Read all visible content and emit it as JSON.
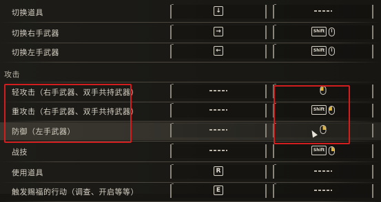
{
  "rows": [
    {
      "label": "切换道具",
      "primary": {
        "kind": "key",
        "text": "↓"
      },
      "secondary": {
        "kind": "dash"
      }
    },
    {
      "label": "切换右手武器",
      "primary": {
        "kind": "key",
        "text": "→"
      },
      "secondary": {
        "kind": "combo",
        "key": "Shift",
        "mouse": "plain"
      }
    },
    {
      "label": "切换左手武器",
      "primary": {
        "kind": "key",
        "text": "←"
      },
      "secondary": {
        "kind": "combo",
        "key": "Shift",
        "mouse": "plain"
      }
    },
    {
      "label": "轻攻击（右手武器、双手共持武器）",
      "primary": {
        "kind": "dash"
      },
      "secondary": {
        "kind": "mouse",
        "mouse": "left"
      }
    },
    {
      "label": "重攻击（右手武器、双手共持武器）",
      "primary": {
        "kind": "dash"
      },
      "secondary": {
        "kind": "combo",
        "key": "Shift",
        "mouse": "left"
      }
    },
    {
      "label": "防御（左手武器）",
      "primary": {
        "kind": "dash"
      },
      "secondary": {
        "kind": "mouse",
        "mouse": "right"
      }
    },
    {
      "label": "战技",
      "primary": {
        "kind": "dash"
      },
      "secondary": {
        "kind": "combo",
        "key": "Shift",
        "mouse": "right"
      }
    },
    {
      "label": "使用道具",
      "primary": {
        "kind": "key",
        "text": "R"
      },
      "secondary": {
        "kind": "dash"
      }
    },
    {
      "label": "触发赐福的行动（调查、开启等等）",
      "primary": {
        "kind": "key",
        "text": "E"
      },
      "secondary": {
        "kind": "dash"
      }
    }
  ],
  "section_title": "攻击",
  "highlighted_row": 5,
  "annotation_color": "#d21e1e"
}
